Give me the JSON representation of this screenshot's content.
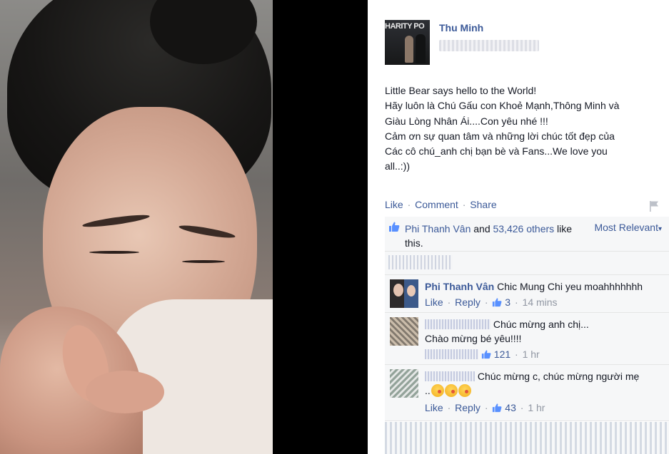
{
  "post": {
    "author": "Thu Minh",
    "avatar_banner": "HARITY PO",
    "text_lines": [
      "Little Bear says hello to the World!",
      "Hãy luôn là Chú Gấu con Khoẻ Mạnh,Thông Minh và",
      "Giàu Lòng Nhân Ái....Con yêu nhé !!!",
      "Cảm ơn sự quan tâm và những lời chúc tốt đẹp của",
      "Các cô chú_anh chị bạn bè và Fans...We love you",
      "all..:))"
    ],
    "actions": {
      "like": "Like",
      "comment": "Comment",
      "share": "Share",
      "separator": "·"
    }
  },
  "likes": {
    "liker": "Phi Thanh Vân",
    "and": "and",
    "others": "53,426 others",
    "suffix": "like this.",
    "sort_label": "Most Relevant"
  },
  "comments": [
    {
      "name": "Phi Thanh Vân",
      "lines": [
        "Chic Mung Chi yeu moahhhhhhh"
      ],
      "like": "Like",
      "reply": "Reply",
      "likes": "3",
      "time": "14 mins"
    },
    {
      "lines": [
        "Chúc mừng anh chị...",
        "Chào mừng bé yêu!!!!"
      ],
      "likes": "121",
      "time": "1 hr"
    },
    {
      "lines": [
        "Chúc mừng c, chúc mừng người mẹ",
        ".."
      ],
      "like": "Like",
      "reply": "Reply",
      "likes": "43",
      "time": "1 hr"
    }
  ],
  "colors": {
    "link": "#3b5998",
    "text": "#141823",
    "muted": "#9197a3",
    "box": "#f6f7f8"
  }
}
